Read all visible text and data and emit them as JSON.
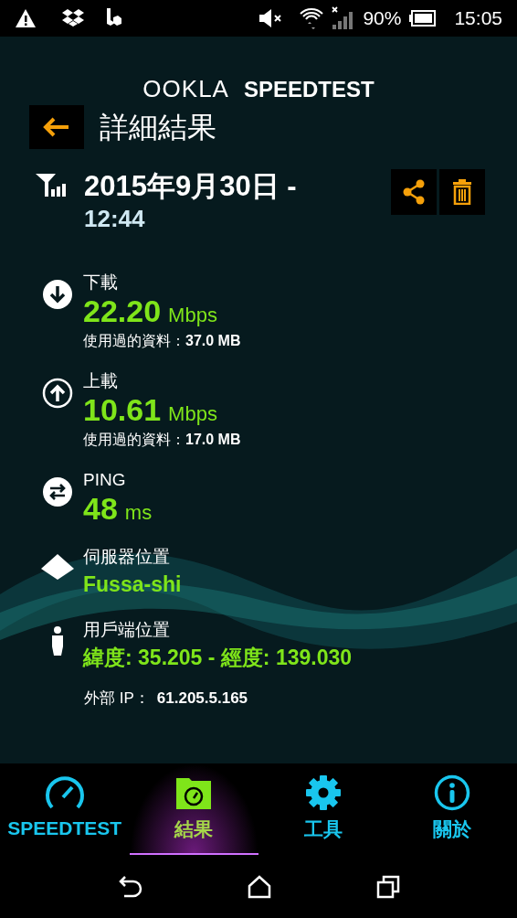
{
  "status_bar": {
    "battery": "90%",
    "time": "15:05"
  },
  "logo": {
    "brand": "OOKLA",
    "product": "SPEEDTEST"
  },
  "header": {
    "title": "詳細結果"
  },
  "result": {
    "date": "2015年9月30日 -",
    "time": "12:44"
  },
  "metrics": [
    {
      "kind": "download",
      "label": "下載",
      "value": "22.20",
      "unit": "Mbps",
      "note_label": "使用過的資料：",
      "note_value": "37.0 MB"
    },
    {
      "kind": "upload",
      "label": "上載",
      "value": "10.61",
      "unit": "Mbps",
      "note_label": "使用過的資料：",
      "note_value": "17.0 MB"
    },
    {
      "kind": "ping",
      "label": "PING",
      "value": "48",
      "unit": "ms"
    },
    {
      "kind": "server",
      "label": "伺服器位置",
      "value": "Fussa-shi"
    },
    {
      "kind": "client",
      "label": "用戶端位置",
      "value": "緯度: 35.205 - 經度: 139.030"
    }
  ],
  "external_ip": {
    "label": "外部 IP：",
    "value": "61.205.5.165"
  },
  "nav": [
    {
      "kind": "speedtest",
      "label": "SPEEDTEST",
      "selected": false
    },
    {
      "kind": "results",
      "label": "結果",
      "selected": true
    },
    {
      "kind": "tools",
      "label": "工具",
      "selected": false
    },
    {
      "kind": "about",
      "label": "關於",
      "selected": false
    }
  ]
}
